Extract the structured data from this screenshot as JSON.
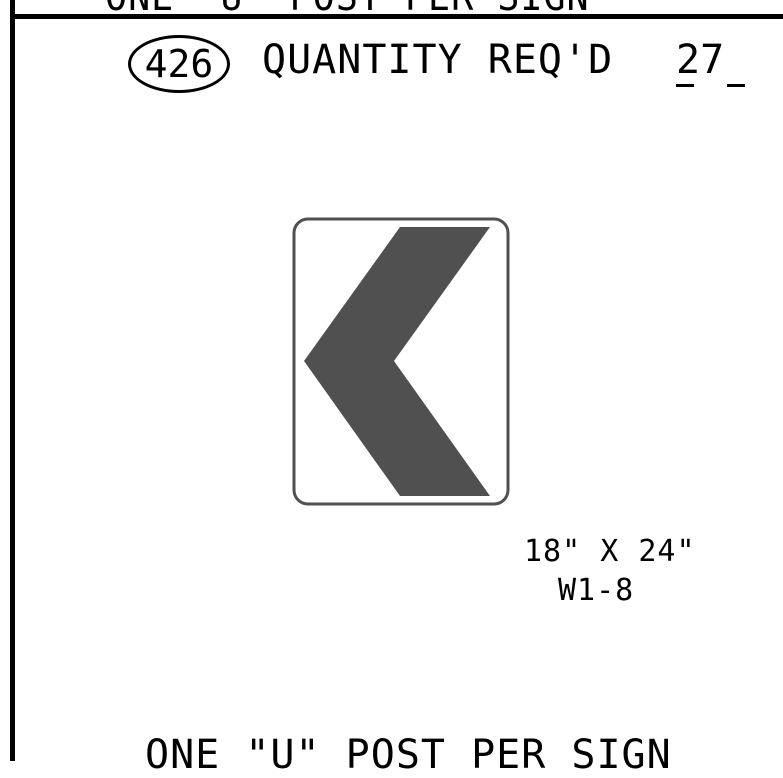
{
  "top_clipped_note": "ONE \"U\" POST PER SIGN",
  "item": {
    "number": "426",
    "quantity_label": "QUANTITY REQ'D",
    "quantity_value": "27"
  },
  "sign": {
    "fill_color": "#505050",
    "border_color": "#505050",
    "symbol": "chevron-left"
  },
  "sign_size": "18\" X 24\"",
  "sign_code": "W1-8",
  "bottom_note": "ONE \"U\" POST PER SIGN"
}
